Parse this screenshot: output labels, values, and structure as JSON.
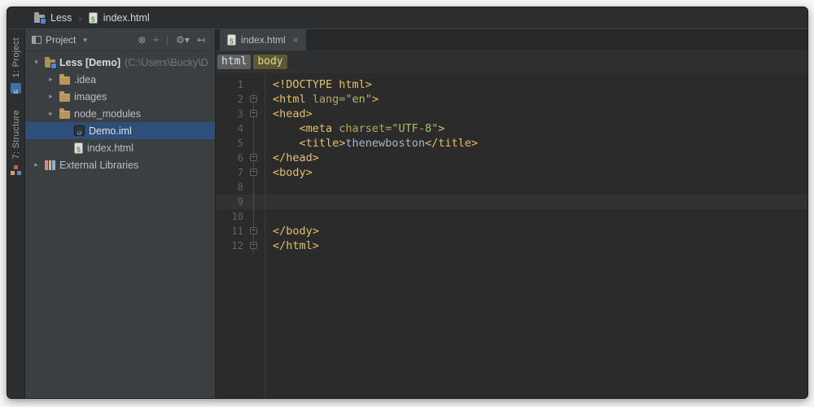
{
  "colors": {
    "panel_bg": "#3C3F41",
    "editor_bg": "#2B2B2B",
    "selection_blue": "#2E4F79",
    "tag": "#E8BF6A",
    "attribute": "#B3A666",
    "string": "#A5C261",
    "plain_text": "#A9B7C6",
    "line_number": "#606366",
    "caret_line_bg": "#323232",
    "breadcrumb_html_bg": "#5D5F60",
    "breadcrumb_body_bg": "#5C5835"
  },
  "title_bar": {
    "separator": "›",
    "items": [
      {
        "icon": "project-folder-icon",
        "label": "Less"
      },
      {
        "icon": "html-file-icon",
        "label": "index.html"
      }
    ]
  },
  "tool_stripe": {
    "items": [
      {
        "label": "1: Project",
        "icon": "project-tool-icon",
        "active": true
      },
      {
        "label": "7: Structure",
        "icon": "structure-tool-icon",
        "active": false
      }
    ]
  },
  "project_panel": {
    "header": {
      "title": "Project",
      "dropdown_glyph": "▾",
      "icons": [
        {
          "name": "locate-icon",
          "glyph": "⊗"
        },
        {
          "name": "collapse-all-icon",
          "glyph": "÷"
        },
        {
          "name": "toolbar-separator",
          "glyph": "|"
        },
        {
          "name": "settings-gear-icon",
          "glyph": "⚙▾"
        },
        {
          "name": "hide-panel-icon",
          "glyph": "↤"
        }
      ]
    },
    "tree": [
      {
        "label": "Less [Demo]",
        "path_suffix": " (C:\\Users\\Bucky\\D",
        "icon": "module",
        "chevron": "expanded",
        "indent": 0,
        "selected": false,
        "emphasis": true
      },
      {
        "label": ".idea",
        "icon": "folder",
        "chevron": "collapsed",
        "indent": 1,
        "selected": false,
        "emphasis": false
      },
      {
        "label": "images",
        "icon": "folder",
        "chevron": "collapsed",
        "indent": 1,
        "selected": false,
        "emphasis": false
      },
      {
        "label": "node_modules",
        "icon": "folder",
        "chevron": "collapsed",
        "indent": 1,
        "selected": false,
        "emphasis": false
      },
      {
        "label": "Demo.iml",
        "icon": "iml",
        "chevron": "none",
        "indent": 2,
        "selected": true,
        "emphasis": false
      },
      {
        "label": "index.html",
        "icon": "html",
        "chevron": "none",
        "indent": 2,
        "selected": false,
        "emphasis": false
      },
      {
        "label": "External Libraries",
        "icon": "libs",
        "chevron": "collapsed",
        "indent": 0,
        "selected": false,
        "emphasis": false
      }
    ]
  },
  "editor": {
    "tabs": [
      {
        "label": "index.html",
        "icon": "html-file-icon",
        "close_glyph": "×",
        "active": true
      }
    ],
    "breadcrumbs": [
      {
        "label": "html",
        "style": "html"
      },
      {
        "label": "body",
        "style": "body"
      }
    ],
    "lines": [
      {
        "num": "1",
        "fold": "",
        "caret": false,
        "segments": [
          {
            "c": "tag",
            "t": "<!DOCTYPE html>"
          }
        ]
      },
      {
        "num": "2",
        "fold": "start",
        "caret": false,
        "segments": [
          {
            "c": "tag",
            "t": "<html "
          },
          {
            "c": "attr",
            "t": "lang="
          },
          {
            "c": "str",
            "t": "\"en\""
          },
          {
            "c": "tag",
            "t": ">"
          }
        ]
      },
      {
        "num": "3",
        "fold": "start",
        "caret": false,
        "segments": [
          {
            "c": "tag",
            "t": "<head>"
          }
        ]
      },
      {
        "num": "4",
        "fold": "",
        "caret": false,
        "segments": [
          {
            "c": "txt",
            "t": "    "
          },
          {
            "c": "tag",
            "t": "<meta "
          },
          {
            "c": "attr",
            "t": "charset="
          },
          {
            "c": "str",
            "t": "\"UTF-8\""
          },
          {
            "c": "tag",
            "t": ">"
          }
        ]
      },
      {
        "num": "5",
        "fold": "",
        "caret": false,
        "segments": [
          {
            "c": "txt",
            "t": "    "
          },
          {
            "c": "tag",
            "t": "<title>"
          },
          {
            "c": "txt",
            "t": "thenewboston"
          },
          {
            "c": "tag",
            "t": "</title>"
          }
        ]
      },
      {
        "num": "6",
        "fold": "end",
        "caret": false,
        "segments": [
          {
            "c": "tag",
            "t": "</head>"
          }
        ]
      },
      {
        "num": "7",
        "fold": "start",
        "caret": false,
        "segments": [
          {
            "c": "tag",
            "t": "<body>"
          }
        ]
      },
      {
        "num": "8",
        "fold": "",
        "caret": false,
        "segments": []
      },
      {
        "num": "9",
        "fold": "",
        "caret": true,
        "segments": []
      },
      {
        "num": "10",
        "fold": "",
        "caret": false,
        "segments": []
      },
      {
        "num": "11",
        "fold": "end",
        "caret": false,
        "segments": [
          {
            "c": "tag",
            "t": "</body>"
          }
        ]
      },
      {
        "num": "12",
        "fold": "end",
        "caret": false,
        "segments": [
          {
            "c": "tag",
            "t": "</html>"
          }
        ]
      }
    ]
  }
}
